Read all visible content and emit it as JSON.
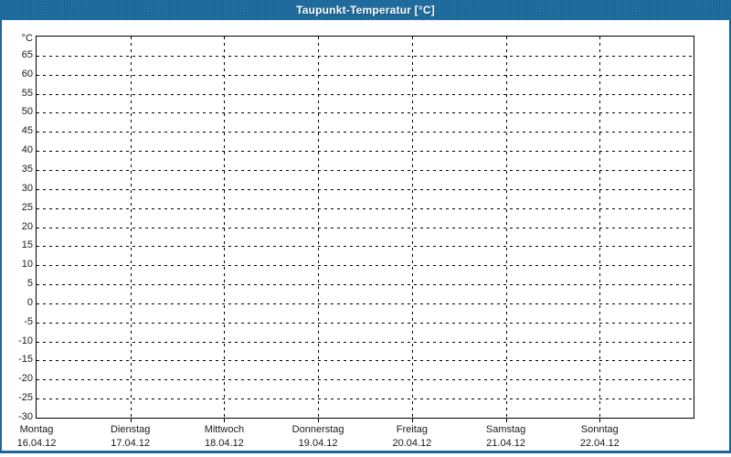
{
  "window": {
    "title": "Taupunkt-Temperatur [°C]"
  },
  "colors": {
    "titlebar_bg": "#2171a6",
    "titlebar_text": "#ffffff",
    "window_border": "#1e6698",
    "plot_border": "#000000",
    "grid_line": "#000000",
    "label_text": "#1a1a1a",
    "content_bg": "#ffffff"
  },
  "chart_data": {
    "type": "line",
    "title": "Taupunkt-Temperatur [°C]",
    "y_axis": {
      "unit_label": "°C",
      "min": -30,
      "max": 70,
      "tick_step": 5,
      "tick_values": [
        65,
        60,
        55,
        50,
        45,
        40,
        35,
        30,
        25,
        20,
        15,
        10,
        5,
        0,
        -5,
        -10,
        -15,
        -20,
        -25,
        -30
      ],
      "grid": "dashed"
    },
    "x_axis": {
      "categories": [
        {
          "day": "Montag",
          "date": "16.04.12"
        },
        {
          "day": "Dienstag",
          "date": "17.04.12"
        },
        {
          "day": "Mittwoch",
          "date": "18.04.12"
        },
        {
          "day": "Donnerstag",
          "date": "19.04.12"
        },
        {
          "day": "Freitag",
          "date": "20.04.12"
        },
        {
          "day": "Samstag",
          "date": "21.04.12"
        },
        {
          "day": "Sonntag",
          "date": "22.04.12"
        }
      ],
      "grid": "dashed"
    },
    "series": [],
    "legend": "none"
  }
}
